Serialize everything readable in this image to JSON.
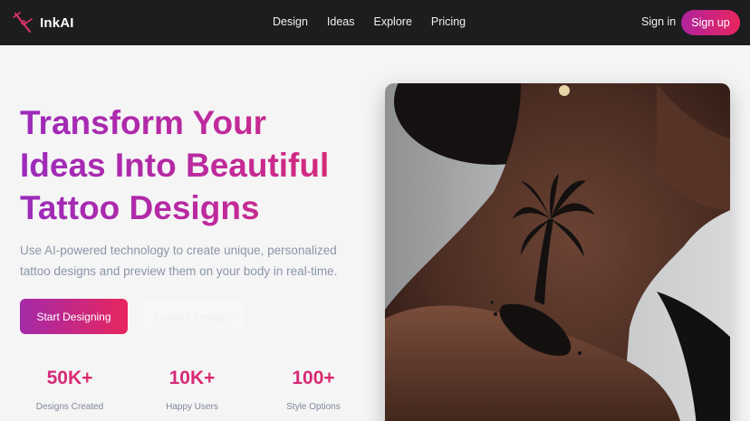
{
  "nav": {
    "brand": "InkAI",
    "links": [
      "Design",
      "Ideas",
      "Explore",
      "Pricing"
    ],
    "signin": "Sign in",
    "signup": "Sign up"
  },
  "hero": {
    "title_lines": [
      "Transform Your",
      "Ideas Into Beautiful",
      "Tattoo Designs"
    ],
    "subtitle": "Use AI-powered technology to create unique, personalized tattoo designs and preview them on your body in real-time.",
    "primary_button": "Start Designing",
    "secondary_button": "Explore Designs"
  },
  "stats": [
    {
      "value": "50K+",
      "label": "Designs Created"
    },
    {
      "value": "10K+",
      "label": "Happy Users"
    },
    {
      "value": "100+",
      "label": "Style Options"
    }
  ],
  "colors": {
    "nav_bg": "#1d1d1f",
    "accent_start": "#9b2bbb",
    "accent_end": "#e8255e",
    "page_bg": "#f5f5f6"
  },
  "icons": {
    "brand": "tattoo-needle-icon"
  }
}
